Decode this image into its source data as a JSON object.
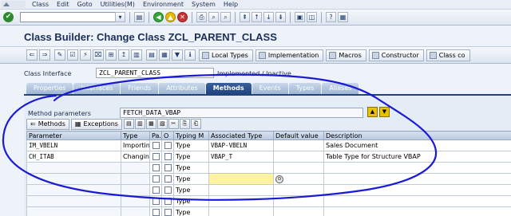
{
  "menubar": {
    "items": [
      "Class",
      "Edit",
      "Goto",
      "Utilities(M)",
      "Environment",
      "System",
      "Help"
    ]
  },
  "title": "Class Builder: Change Class ZCL_PARENT_CLASS",
  "app_toolbar": {
    "local_types": "Local Types",
    "implementation": "Implementation",
    "macros": "Macros",
    "constructor": "Constructor",
    "class_co": "Class co"
  },
  "header": {
    "label": "Class Interface",
    "value": "ZCL_PARENT_CLASS",
    "status": "Implemented / Inactive"
  },
  "tabs": [
    {
      "label": "Properties"
    },
    {
      "label": "Interfaces"
    },
    {
      "label": "Friends"
    },
    {
      "label": "Attributes"
    },
    {
      "label": "Methods"
    },
    {
      "label": "Events"
    },
    {
      "label": "Types"
    },
    {
      "label": "Aliases"
    }
  ],
  "method_params": {
    "label": "Method parameters",
    "value": "FETCH_DATA_VBAP"
  },
  "grid_toolbar": {
    "methods": "Methods",
    "exceptions": "Exceptions"
  },
  "grid": {
    "columns": [
      "Parameter",
      "Type",
      "Pa.",
      "O",
      "Typing M",
      "Associated Type",
      "Default value",
      "Description"
    ],
    "rows": [
      {
        "parameter": "IM_VBELN",
        "type": "Importing",
        "typing": "Type",
        "assoc": "VBAP-VBELN",
        "default": "",
        "description": "Sales Document"
      },
      {
        "parameter": "CH_ITAB",
        "type": "Changing",
        "typing": "Type",
        "assoc": "VBAP_T",
        "default": "",
        "description": "Table Type for Structure VBAP"
      },
      {
        "parameter": "",
        "type": "",
        "typing": "Type",
        "assoc": "",
        "default": "",
        "description": ""
      },
      {
        "parameter": "",
        "type": "",
        "typing": "Type",
        "assoc": "",
        "default": "",
        "description": ""
      },
      {
        "parameter": "",
        "type": "",
        "typing": "Type",
        "assoc": "",
        "default": "",
        "description": ""
      },
      {
        "parameter": "",
        "type": "",
        "typing": "Type",
        "assoc": "",
        "default": "",
        "description": ""
      },
      {
        "parameter": "",
        "type": "",
        "typing": "Type",
        "assoc": "",
        "default": "",
        "description": ""
      }
    ]
  },
  "colors": {
    "tab_active": "#21447f",
    "focus_cell": "#fff3a0",
    "annotation": "#1a1ad6"
  }
}
